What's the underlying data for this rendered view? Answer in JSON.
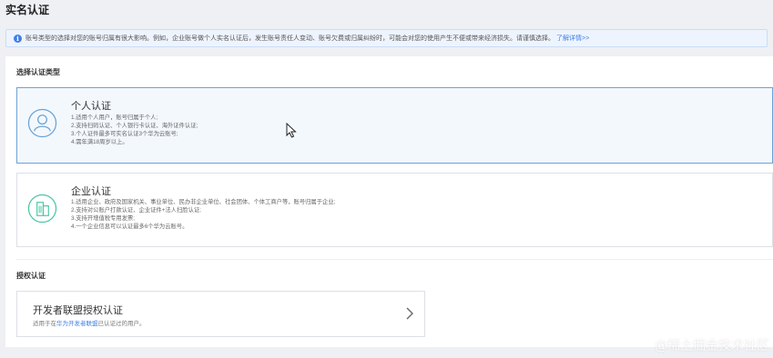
{
  "page": {
    "title": "实名认证"
  },
  "notice": {
    "icon": "info-icon",
    "text": "账号类型的选择对您的账号归属有很大影响。例如，企业账号做个人实名认证后，发生账号责任人变动、账号欠费或归属纠纷时，可能会对您的使用产生不便或带来经济损失。请谨慎选择。",
    "link": "了解详情>>"
  },
  "select_section": {
    "title": "选择认证类型"
  },
  "personal": {
    "icon": "person-icon",
    "title": "个人认证",
    "lines": [
      "1.适用个人用户，账号归属于个人;",
      "2.支持扫码认证、个人银行卡认证、海外证件认证;",
      "3.个人证件最多可实名认证3个华为云账号;",
      "4.需年满18周岁以上。"
    ]
  },
  "enterprise": {
    "icon": "building-icon",
    "title": "企业认证",
    "lines": [
      "1.适用企业、政府及国家机关、事业单位、民办非企业单位、社会团体、个体工商户等，账号归属于企业;",
      "2.支持对公账户打款认证、企业证件+法人扫脸认证;",
      "3.支持开增值税专用发票;",
      "4.一个企业信息可以认证最多6个华为云账号。"
    ]
  },
  "auth_section": {
    "title": "授权认证"
  },
  "developer": {
    "title": "开发者联盟授权认证",
    "sub_prefix": "适用于在",
    "sub_link": "华为开发者联盟",
    "sub_suffix": "已认证过的用户。",
    "icon": "chevron-right-icon"
  },
  "watermark": "@稀土掘金技术社区",
  "colors": {
    "accent": "#3f7fe8",
    "selected_border": "#6aa3d5",
    "selected_bg": "#f3f8fd",
    "personal_icon": "#6aa3d5",
    "enterprise_icon": "#4cc7a4"
  }
}
